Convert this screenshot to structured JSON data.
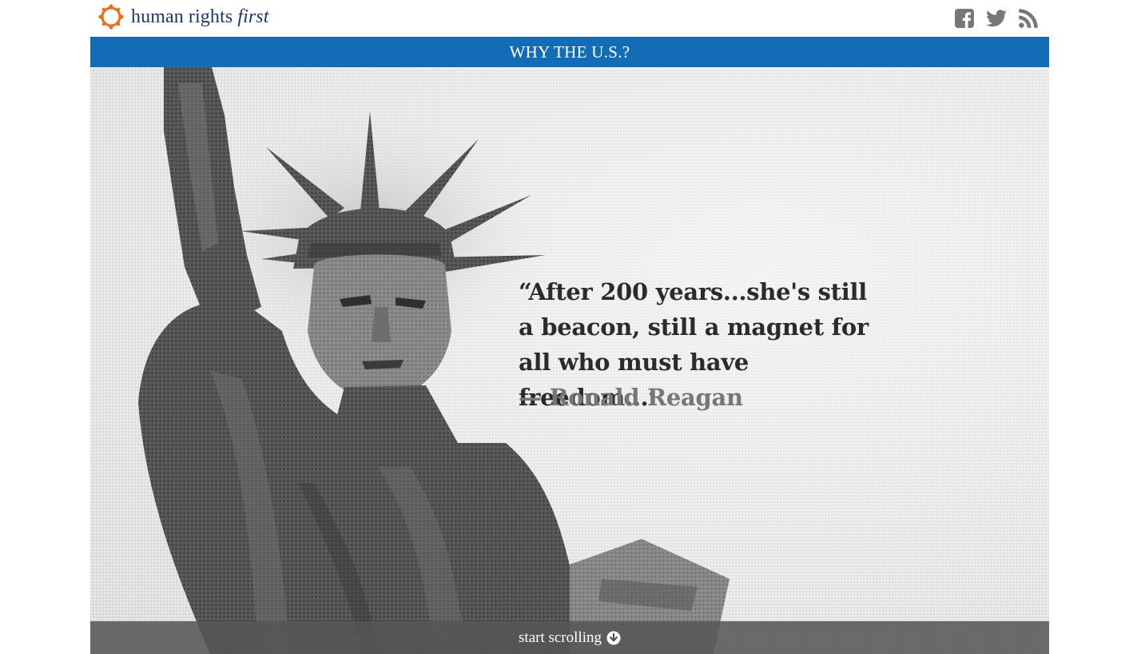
{
  "brand": {
    "name_main": "human rights",
    "name_emphasis": "first",
    "colors": {
      "logo_orange": "#e8731d",
      "logo_text": "#1e3765"
    }
  },
  "social": [
    {
      "name": "facebook",
      "icon": "facebook-icon"
    },
    {
      "name": "twitter",
      "icon": "twitter-icon"
    },
    {
      "name": "rss",
      "icon": "rss-icon"
    }
  ],
  "banner": {
    "title": "WHY THE U.S.?",
    "color": "#136cb6"
  },
  "hero": {
    "quote": "“After 200 years...she's still a beacon, still a magnet for all who must have freedom...’",
    "attribution": "— Ronald Reagan"
  },
  "footer_bar": {
    "label": "start scrolling",
    "icon": "arrow-circle-down-icon"
  }
}
